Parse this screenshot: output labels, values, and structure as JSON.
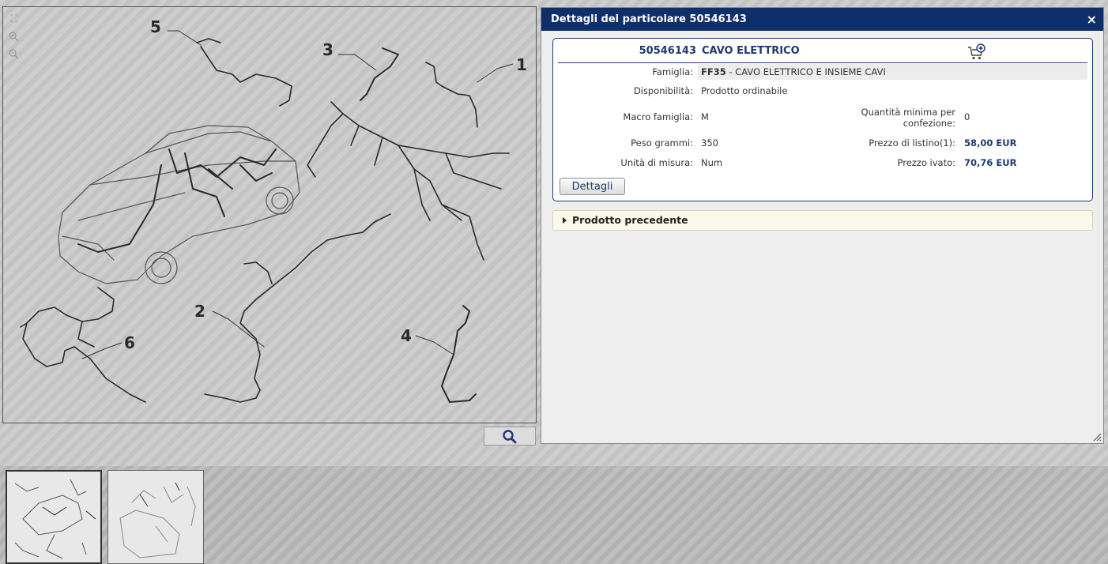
{
  "dialog": {
    "title": "Dettagli del particolare 50546143",
    "close_icon": "×"
  },
  "part": {
    "number": "50546143",
    "name": "CAVO ELETTRICO",
    "famiglia_label": "Famiglia:",
    "famiglia_code": "FF35",
    "famiglia_desc": " - CAVO ELETTRICO E INSIEME CAVI",
    "disponibilita_label": "Disponibilità:",
    "disponibilita_value": "Prodotto ordinabile",
    "macro_label": "Macro famiglia:",
    "macro_value": "M",
    "qty_label": "Quantità minima per confezione:",
    "qty_value": "0",
    "peso_label": "Peso grammi:",
    "peso_value": "350",
    "listino_label": "Prezzo di listino(1):",
    "listino_value": "58,00 EUR",
    "unita_label": "Unità di misura:",
    "unita_value": "Num",
    "ivato_label": "Prezzo ivato:",
    "ivato_value": "70,76 EUR"
  },
  "buttons": {
    "details_label": "Dettagli"
  },
  "previous": {
    "label": "Prodotto precedente"
  },
  "drawing": {
    "callouts": [
      "1",
      "2",
      "3",
      "4",
      "5",
      "6"
    ]
  },
  "icons": {
    "fit": "fit-to-window-icon",
    "zoom_in": "zoom-in-icon",
    "zoom_out": "zoom-out-icon",
    "magnifier": "magnifier-icon",
    "cart": "add-to-cart-icon",
    "resize": "resize-grip-icon",
    "arrow": "caret-right-icon"
  },
  "colors": {
    "header_bg": "#0e2f6a",
    "accent_text": "#1e3a6e",
    "prev_bar_bg": "#fbf9ea"
  }
}
